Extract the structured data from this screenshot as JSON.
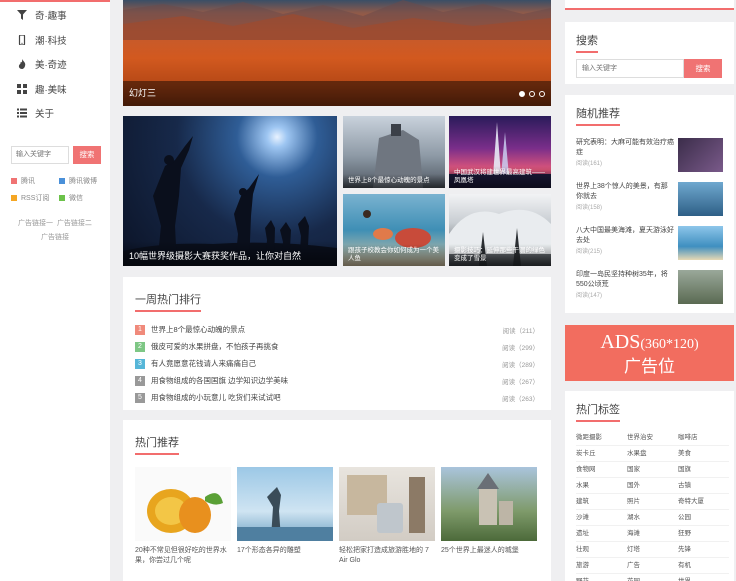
{
  "sidebar": {
    "nav": [
      {
        "label": "奇·趣事",
        "icon": "filter-icon"
      },
      {
        "label": "潮·科技",
        "icon": "phone-icon"
      },
      {
        "label": "美·奇迹",
        "icon": "fire-icon"
      },
      {
        "label": "趣·美味",
        "icon": "grid-icon"
      },
      {
        "label": "关于",
        "icon": "list-icon"
      }
    ],
    "search_placeholder": "输入关键字",
    "search_button": "搜索",
    "links": [
      {
        "label": "腾讯",
        "color": "#f07373"
      },
      {
        "label": "腾讯微博",
        "color": "#4a90d9"
      },
      {
        "label": "RSS订阅",
        "color": "#f5a623"
      },
      {
        "label": "微信",
        "color": "#6cc24a"
      }
    ],
    "ad_links": [
      "广告链接一",
      "广告链接二",
      "广告链接"
    ]
  },
  "slider": {
    "caption": "幻灯三",
    "dots": 3,
    "active_dot": 0
  },
  "gallery": {
    "big_caption": "10幅世界级摄影大赛获奖作品，让你对自然",
    "items": [
      {
        "caption": "世界上8个最惊心动魄的景点"
      },
      {
        "caption": "中国武汉将建世界最高建筑——凤凰塔"
      },
      {
        "caption": "跟孩子校教会你如何成为一个美人鱼"
      },
      {
        "caption": "摄影技巧：延伸那些干涸的绿色变成了雪景"
      }
    ]
  },
  "hot_week": {
    "title": "一周热门排行",
    "items": [
      {
        "rank": "1",
        "title": "世界上8个最惊心动魄的景点",
        "views": "阅读（211）",
        "color": "#f08a7b"
      },
      {
        "rank": "2",
        "title": "俄皮可爱的水果拼盘，不怕孩子再挑食",
        "views": "阅读（299）",
        "color": "#7ec785"
      },
      {
        "rank": "3",
        "title": "有人竟愿意花钱请人来痛痛自己",
        "views": "阅读（289）",
        "color": "#56b6d8"
      },
      {
        "rank": "4",
        "title": "用食物组成的各国国旗 边学知识边学美味",
        "views": "阅读（267）",
        "color": "#999999"
      },
      {
        "rank": "5",
        "title": "用食物组成的小玩意儿 吃货们来试试吧",
        "views": "阅读（263）",
        "color": "#999999"
      }
    ]
  },
  "hot_recommend": {
    "title": "热门推荐",
    "items": [
      {
        "text": "20种不常见但很好吃的世界水果，你尝过几个呢"
      },
      {
        "text": "17个形态各异的雕塑"
      },
      {
        "text": "轻松把家打造成旅游胜地的 7 Air Glo"
      },
      {
        "text": "25个世界上最迷人的城堡"
      }
    ]
  },
  "right": {
    "search_title": "搜索",
    "search_placeholder": "输入关键字",
    "search_button": "搜索",
    "random_title": "随机推荐",
    "random": [
      {
        "text": "研究表明：大麻可能有效治疗癌症",
        "views": "阅读(161)"
      },
      {
        "text": "世界上38个惊人的美景，有那你就去",
        "views": "阅读(158)"
      },
      {
        "text": "八大中国最美海滩，夏天游泳好去处",
        "views": "阅读(215)"
      },
      {
        "text": "印度一岛民坚持种树35年，将550公顷荒",
        "views": "阅读(147)"
      }
    ],
    "ads_line1": "ADS",
    "ads_size": "(360*120)",
    "ads_line2": "广告位",
    "tags_title": "热门标签",
    "tags": [
      "微距摄影",
      "世界治安",
      "咖啡店",
      "炭卡丘",
      "水果盘",
      "美食",
      "食物网",
      "国家",
      "国旗",
      "水果",
      "国外",
      "古镇",
      "建筑",
      "照片",
      "奇特大厦",
      "沙滩",
      "湖水",
      "公园",
      "遗址",
      "海滩",
      "狂野",
      "壮观",
      "灯塔",
      "先锋",
      "旅游",
      "广告",
      "有机",
      "野花",
      "花园",
      "世界"
    ]
  }
}
